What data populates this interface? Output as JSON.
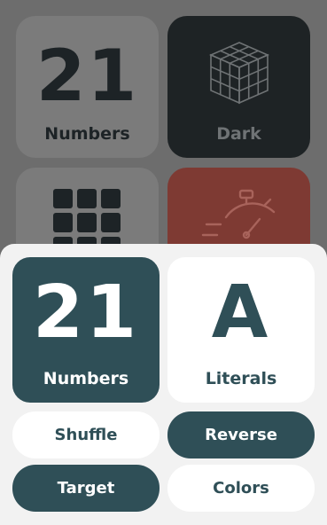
{
  "background": {
    "numbers_tile": {
      "big": "21",
      "label": "Numbers"
    },
    "dark_tile": {
      "label": "Dark",
      "icon": "cube-icon"
    },
    "grid_tile": {
      "icon": "grid-icon"
    },
    "timer_tile": {
      "icon": "stopwatch-icon"
    }
  },
  "sheet": {
    "numbers_card": {
      "big": "21",
      "label": "Numbers"
    },
    "literals_card": {
      "big": "A",
      "label": "Literals"
    },
    "buttons": {
      "shuffle": "Shuffle",
      "reverse": "Reverse",
      "target": "Target",
      "colors": "Colors"
    }
  },
  "colors": {
    "accent": "#2f4f57",
    "sheet_bg": "#f2f2f2",
    "overlay_bg": "#6d6d6d"
  }
}
